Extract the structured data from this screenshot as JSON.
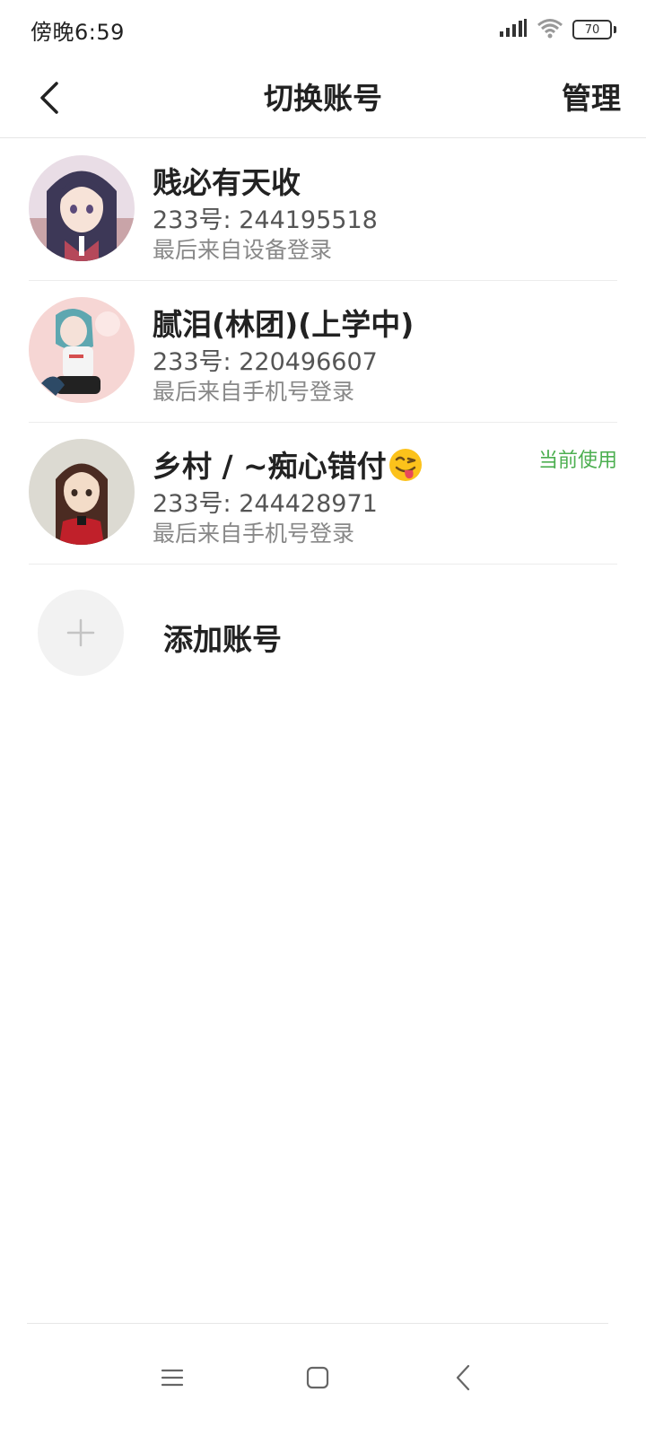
{
  "status_bar": {
    "time": "傍晚6:59",
    "battery": "70"
  },
  "header": {
    "title": "切换账号",
    "manage_label": "管理"
  },
  "accounts": [
    {
      "name": "贱必有天收",
      "id_text": "233号: 244195518",
      "login_text": "最后来自设备登录",
      "current": ""
    },
    {
      "name": "腻泪(林团)(上学中)",
      "id_text": "233号: 220496607",
      "login_text": "最后来自手机号登录",
      "current": ""
    },
    {
      "name": "乡村 / ~痴心错付",
      "id_text": "233号: 244428971",
      "login_text": "最后来自手机号登录",
      "current": "当前使用"
    }
  ],
  "add_account": {
    "label": "添加账号"
  },
  "colors": {
    "current_badge": "#4caf50",
    "divider": "#ececec"
  },
  "icons": [
    "back-icon",
    "signal-icon",
    "wifi-icon",
    "battery-icon",
    "plus-icon",
    "menu-icon",
    "home-icon",
    "nav-back-icon",
    "tongue-emoji-icon"
  ]
}
